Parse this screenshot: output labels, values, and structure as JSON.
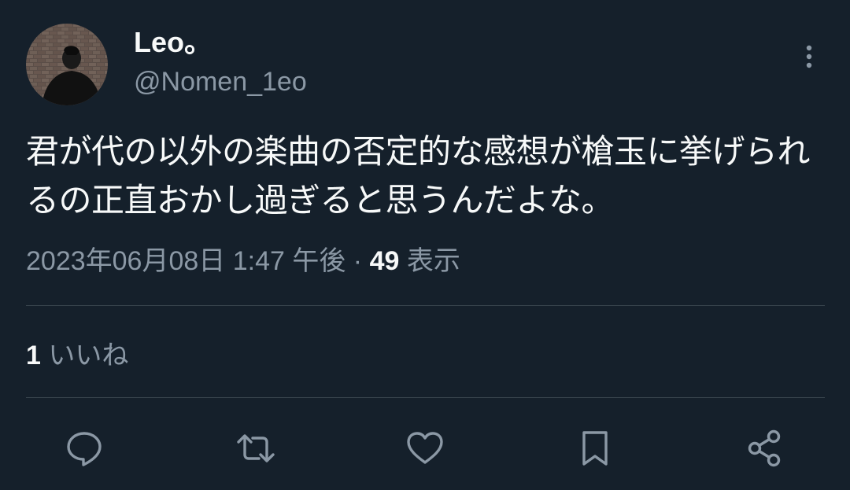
{
  "author": {
    "display_name": "Leo。",
    "handle": "@Nomen_1eo"
  },
  "tweet": {
    "text": "君が代の以外の楽曲の否定的な感想が槍玉に挙げられるの正直おかし過ぎると思うんだよな。",
    "timestamp": "2023年06月08日 1:47 午後",
    "separator": " · ",
    "views_count": "49",
    "views_label": " 表示"
  },
  "stats": {
    "likes_count": "1",
    "likes_label": " いいね"
  },
  "icons": {
    "more": "more-vertical-icon",
    "reply": "reply-icon",
    "retweet": "retweet-icon",
    "like": "heart-icon",
    "bookmark": "bookmark-icon",
    "share": "share-icon"
  },
  "colors": {
    "background": "#15202b",
    "text_primary": "#f7f9f9",
    "text_secondary": "#8b98a5",
    "divider": "#38444d"
  }
}
